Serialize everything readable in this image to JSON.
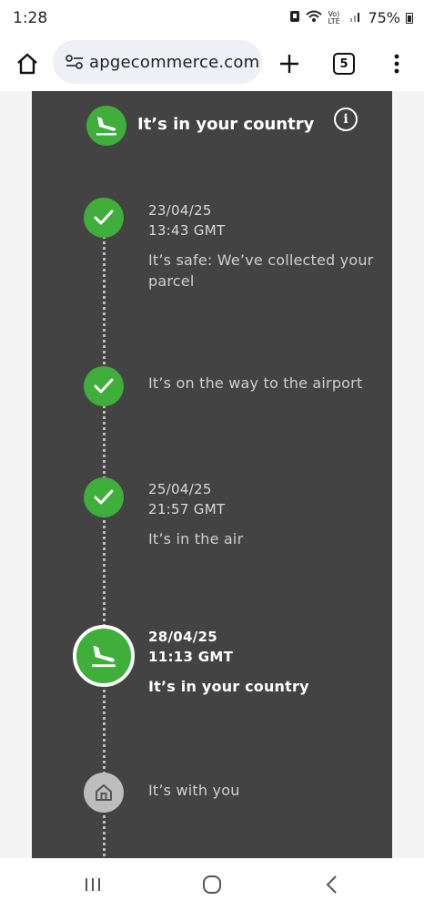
{
  "status_bar": {
    "time": "1:28",
    "network_label": "Vo) LTE",
    "battery": "75%"
  },
  "browser": {
    "url": "apgecommerce.com",
    "tab_count": "5"
  },
  "header": {
    "title": "It’s in your country",
    "icon": "plane-landing-icon",
    "info_glyph": "i"
  },
  "timeline": {
    "steps": [
      {
        "date": "23/04/25",
        "time": "13:43 GMT",
        "description": "It’s safe: We’ve collected your parcel",
        "status": "done",
        "icon": "check-icon"
      },
      {
        "date": "",
        "time": "",
        "description": "It’s on the way to the airport",
        "status": "done",
        "icon": "check-icon"
      },
      {
        "date": "25/04/25",
        "time": "21:57 GMT",
        "description": "It’s in the air",
        "status": "done",
        "icon": "check-icon"
      },
      {
        "date": "28/04/25",
        "time": "11:13 GMT",
        "description": "It’s in your country",
        "status": "current",
        "icon": "plane-landing-icon"
      },
      {
        "date": "",
        "time": "",
        "description": "It’s with you",
        "status": "pending",
        "icon": "house-icon"
      }
    ]
  },
  "colors": {
    "panel_bg": "#434343",
    "success_green": "#3fae3a",
    "pending_grey": "#bdbdbd",
    "fab_red": "#dd3b2e"
  }
}
